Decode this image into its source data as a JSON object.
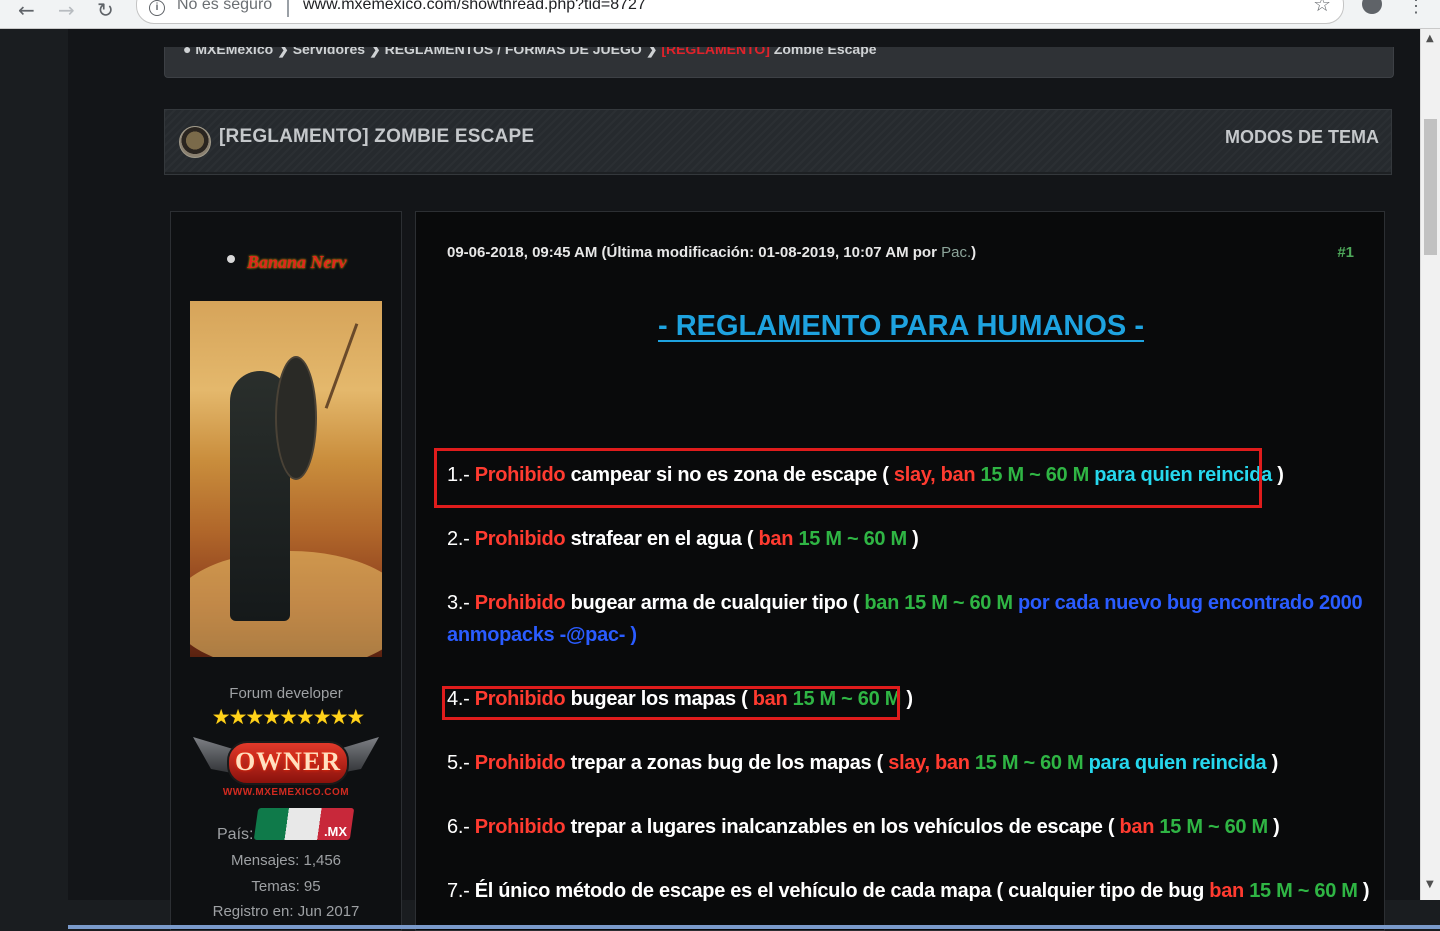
{
  "browser": {
    "security_label": "No es seguro",
    "url": "www.mxemexico.com/showthread.php?tid=8727"
  },
  "breadcrumb": {
    "items": [
      "MXEMexico",
      "Servidores",
      "REGLAMENTOS / FORMAS DE JUEGO"
    ],
    "prefix": "[REGLAMENTO]",
    "current": "Zombie Escape"
  },
  "thread": {
    "title": "[REGLAMENTO] ZOMBIE ESCAPE",
    "modes_label": "MODOS DE TEMA"
  },
  "user": {
    "name": "Banana Nerv",
    "rank": "Forum developer",
    "stars": "★★★★★★★★★",
    "badge_text": "OWNER",
    "badge_site": "WWW.MXEMEXICO.COM",
    "country_label": "País:",
    "country_code": ".MX",
    "posts": "Mensajes: 1,456",
    "threads": "Temas: 95",
    "registered": "Registro en: Jun 2017"
  },
  "post": {
    "date": "09-06-2018, 09:45 AM",
    "edited": "(Última modificación: 01-08-2019, 10:07 AM por",
    "editor": "Pac.",
    "edited_close": ")",
    "number": "#1",
    "heading": "-   REGLAMENTO PARA HUMANOS -"
  },
  "rules": [
    {
      "num": "1.-",
      "parts": [
        {
          "t": "Prohibido",
          "c": "r"
        },
        {
          "t": " campear si no es zona de escape ( ",
          "c": "w"
        },
        {
          "t": "slay, ban",
          "c": "r"
        },
        {
          "t": " 15 M ~ 60 M",
          "c": "g"
        },
        {
          "t": " para quien reincida",
          "c": "c"
        },
        {
          "t": " )",
          "c": "w"
        }
      ]
    },
    {
      "num": "2.-",
      "parts": [
        {
          "t": "Prohibido",
          "c": "r"
        },
        {
          "t": " strafear en el agua ( ",
          "c": "w"
        },
        {
          "t": "ban",
          "c": "r"
        },
        {
          "t": " 15 M ~ 60 M",
          "c": "g"
        },
        {
          "t": " )",
          "c": "w"
        }
      ]
    },
    {
      "num": "3.-",
      "parts": [
        {
          "t": "Prohibido",
          "c": "r"
        },
        {
          "t": " bugear arma de cualquier tipo ( ",
          "c": "w"
        },
        {
          "t": "ban 15 M ~ 60 M",
          "c": "g"
        },
        {
          "t": " por cada nuevo bug encontrado 2000",
          "c": "b"
        }
      ],
      "line2": "anmopacks -@pac- )"
    },
    {
      "num": "4.-",
      "parts": [
        {
          "t": "Prohibido",
          "c": "r"
        },
        {
          "t": " bugear los mapas ( ",
          "c": "w"
        },
        {
          "t": "ban",
          "c": "r"
        },
        {
          "t": " 15 M ~ 60 M",
          "c": "g"
        },
        {
          "t": " )",
          "c": "w"
        }
      ]
    },
    {
      "num": "5.-",
      "parts": [
        {
          "t": "Prohibido",
          "c": "r"
        },
        {
          "t": " trepar a zonas bug de los mapas ( ",
          "c": "w"
        },
        {
          "t": "slay, ban",
          "c": "r"
        },
        {
          "t": " 15 M ~ 60 M",
          "c": "g"
        },
        {
          "t": " para quien reincida",
          "c": "c"
        },
        {
          "t": " )",
          "c": "w"
        }
      ]
    },
    {
      "num": "6.-",
      "parts": [
        {
          "t": "Prohibido",
          "c": "r"
        },
        {
          "t": " trepar a lugares inalcanzables en los vehículos de escape ( ",
          "c": "w"
        },
        {
          "t": "ban",
          "c": "r"
        },
        {
          "t": " 15 M ~ 60 M",
          "c": "g"
        },
        {
          "t": " )",
          "c": "w"
        }
      ]
    },
    {
      "num": "7.-",
      "parts": [
        {
          "t": "Él único método de escape es el vehículo de cada mapa ( cualquier tipo de bug ",
          "c": "w"
        },
        {
          "t": "ban",
          "c": "r"
        },
        {
          "t": " 15 M ~ 60 M",
          "c": "g"
        },
        {
          "t": " )",
          "c": "w"
        }
      ]
    }
  ],
  "colors": {
    "prohibited_red": "#ff3b30",
    "penalty_green": "#2fb544",
    "reincide_cyan": "#26d8ee",
    "note_blue": "#2a5cff",
    "heading_blue": "#1ea3e0",
    "highlight_box": "#e01c1c"
  }
}
